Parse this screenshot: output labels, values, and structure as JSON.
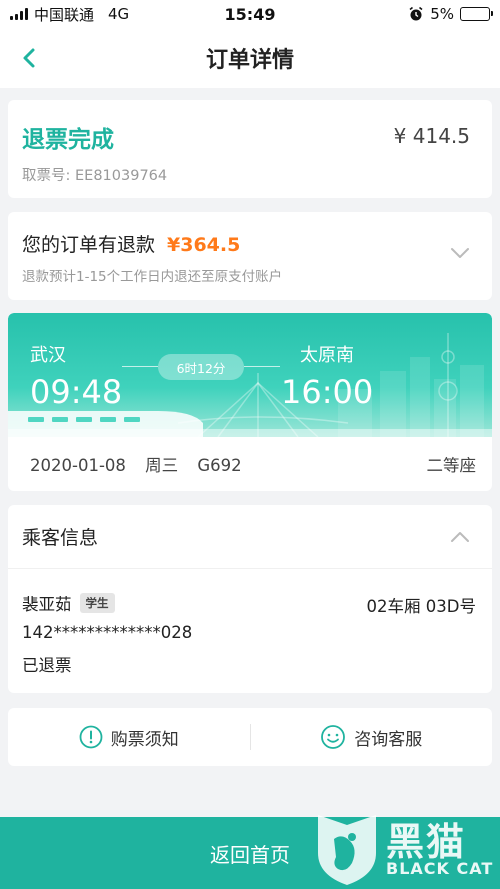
{
  "status_bar": {
    "carrier": "中国联通",
    "network": "4G",
    "time": "15:49",
    "battery": "5%"
  },
  "nav": {
    "title": "订单详情"
  },
  "order": {
    "status": "退票完成",
    "ticket_no": "取票号: EE81039764",
    "price": "¥ 414.5"
  },
  "refund": {
    "title": "您的订单有退款",
    "amount": "¥364.5",
    "note": "退款预计1-15个工作日内退还至原支付账户"
  },
  "trip": {
    "from_station": "武汉",
    "to_station": "太原南",
    "depart_time": "09:48",
    "arrive_time": "16:00",
    "duration": "6时12分",
    "date": "2020-01-08",
    "weekday": "周三",
    "train_no": "G692",
    "seat_class": "二等座"
  },
  "passenger_section": {
    "title": "乘客信息",
    "passengers": [
      {
        "name": "裴亚茹",
        "tag": "学生",
        "seat": "02车厢 03D号",
        "id_no": "142*************028",
        "status": "已退票"
      }
    ]
  },
  "actions": {
    "notice": "购票须知",
    "service": "咨询客服"
  },
  "bottom": {
    "home_button": "返回首页"
  },
  "watermark": {
    "cn": "黑猫",
    "en": "BLACK CAT"
  },
  "colors": {
    "accent": "#1fb39f",
    "refund": "#ff7a1a"
  }
}
